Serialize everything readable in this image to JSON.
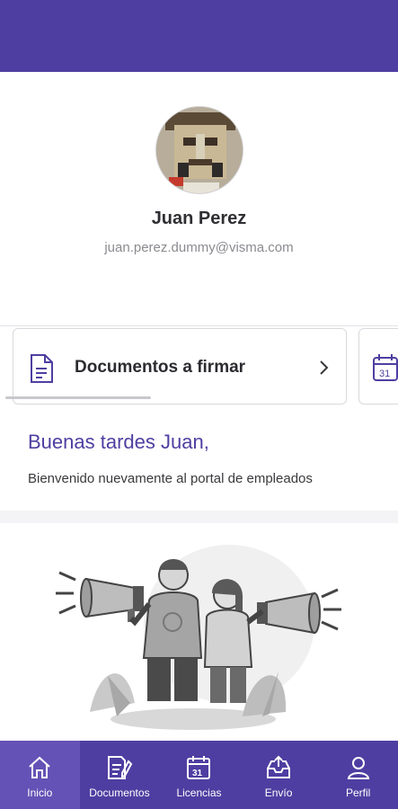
{
  "profile": {
    "name": "Juan Perez",
    "email": "juan.perez.dummy@visma.com"
  },
  "cards": [
    {
      "label": "Documentos a firmar",
      "icon": "document-icon"
    },
    {
      "label": "",
      "icon": "calendar-icon",
      "icon_text": "31"
    }
  ],
  "greeting": {
    "title": "Buenas tardes Juan,",
    "subtitle": "Bienvenido nuevamente al portal de empleados"
  },
  "nav": {
    "items": [
      {
        "label": "Inicio",
        "icon": "home-icon",
        "active": true
      },
      {
        "label": "Documentos",
        "icon": "document-sign-icon",
        "active": false
      },
      {
        "label": "Licencias",
        "icon": "calendar-icon",
        "icon_text": "31",
        "active": false
      },
      {
        "label": "Envío",
        "icon": "inbox-upload-icon",
        "active": false
      },
      {
        "label": "Perfil",
        "icon": "user-icon",
        "active": false
      }
    ]
  },
  "colors": {
    "primary": "#4f3ea1",
    "nav_active": "#6452b6",
    "accent_text": "#4f3ea1"
  }
}
